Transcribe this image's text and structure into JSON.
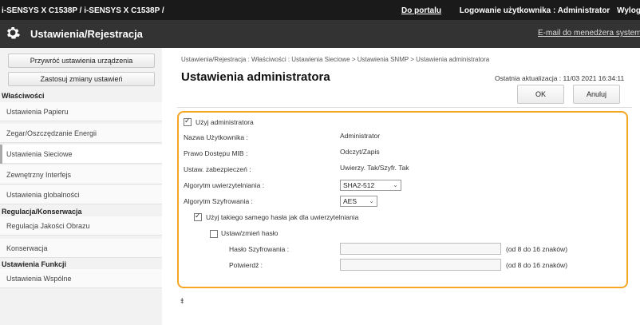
{
  "topbar": {
    "model": "i-SENSYS X C1538P / i-SENSYS X C1538P /",
    "portal_link": "Do portalu",
    "login_user": "Logowanie użytkownika : Administrator",
    "logout": "Wyloguj się"
  },
  "titlebar": {
    "title": "Ustawienia/Rejestracja",
    "email_link": "E-mail do menedżera systemu"
  },
  "sidebar": {
    "btn_restore": "Przywróć ustawienia urządzenia",
    "btn_apply": "Zastosuj zmiany ustawień",
    "sections": [
      {
        "head": "Właściwości",
        "items": [
          "Ustawienia Papieru",
          "Zegar/Oszczędzanie Energii",
          "Ustawienia Sieciowe",
          "Zewnętrzny Interfejs",
          "Ustawienia globalności"
        ]
      },
      {
        "head": "Regulacja/Konserwacja",
        "items": [
          "Regulacja Jakości Obrazu",
          "Konserwacja"
        ]
      },
      {
        "head": "Ustawienia Funkcji",
        "items": [
          "Ustawienia Wspólne"
        ]
      }
    ]
  },
  "main": {
    "breadcrumb": "Ustawienia/Rejestracja : Właściwości : Ustawienia Sieciowe > Ustawienia SNMP > Ustawienia administratora",
    "title": "Ustawienia administratora",
    "updated": "Ostatnia aktualizacja : 11/03 2021 16:34:11",
    "ok": "OK",
    "cancel": "Anuluj",
    "form": {
      "use_admin": "Użyj administratora",
      "username_label": "Nazwa Użytkownika :",
      "username_value": "Administrator",
      "access_label": "Prawo Dostępu MIB :",
      "access_value": "Odczyt/Zapis",
      "security_label": "Ustaw. zabezpieczeń :",
      "security_value": "Uwierzy. Tak/Szyfr. Tak",
      "auth_algo_label": "Algorytm uwierzytelniania :",
      "auth_algo_value": "SHA2-512",
      "enc_algo_label": "Algorytm Szyfrowania :",
      "enc_algo_value": "AES",
      "same_pass": "Użyj takiego samego hasła jak dla uwierzytelniania",
      "set_pass": "Ustaw/zmień hasło",
      "enc_pass_label": "Hasło Szyfrowania :",
      "confirm_label": "Potwierdź :",
      "hint": "(od 8 do 16 znaków)"
    },
    "to_top": "⯒"
  }
}
